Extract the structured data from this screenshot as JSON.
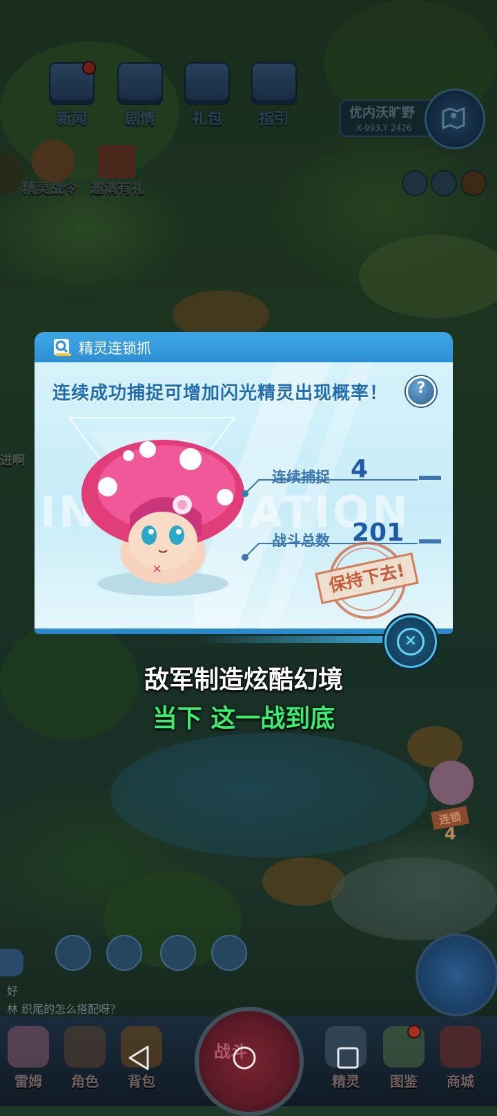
{
  "menu": {
    "items": [
      {
        "label": "新闻",
        "icon": "news-board-icon",
        "badge": true
      },
      {
        "label": "剧情",
        "icon": "story-book-icon",
        "badge": false
      },
      {
        "label": "礼包",
        "icon": "gift-chest-icon",
        "badge": false
      },
      {
        "label": "指引",
        "icon": "guide-book-icon",
        "badge": false
      }
    ]
  },
  "location": {
    "name": "优内沃旷野",
    "coord": "X-993,Y 2426"
  },
  "side_left": {
    "pass_label": "精灵战令",
    "invite_label": "邀请有礼"
  },
  "left_edge_text": "进啊",
  "dialog": {
    "title": "精灵连锁抓",
    "subtitle": "连续成功捕捉可增加闪光精灵出现概率！",
    "help": "?",
    "watermark": "INFORMATION",
    "stats": {
      "streak_label": "连续捕捉",
      "streak_value": "4",
      "battles_label": "战斗总数",
      "battles_value": "201"
    },
    "stamp": "保持下去!",
    "close": "×"
  },
  "subtitles": {
    "line1": "敌军制造炫酷幻境",
    "line2": "当下 这一战到底"
  },
  "event": {
    "label": "连锁",
    "count": "4"
  },
  "chat": {
    "line1": "好",
    "line2": "林     织尾的怎么搭配呀？"
  },
  "bottom_nav": {
    "items": [
      {
        "label": "雷姆"
      },
      {
        "label": "角色"
      },
      {
        "label": "背包"
      },
      {
        "label": "精灵"
      },
      {
        "label": "图鉴"
      },
      {
        "label": "商城"
      }
    ],
    "fight_label": "战斗"
  },
  "colors": {
    "dialog_header": "#3fa7e6",
    "subtitle_green": "#39ef70",
    "stat_blue": "#1e5aa5",
    "stamp": "#c45d38"
  }
}
